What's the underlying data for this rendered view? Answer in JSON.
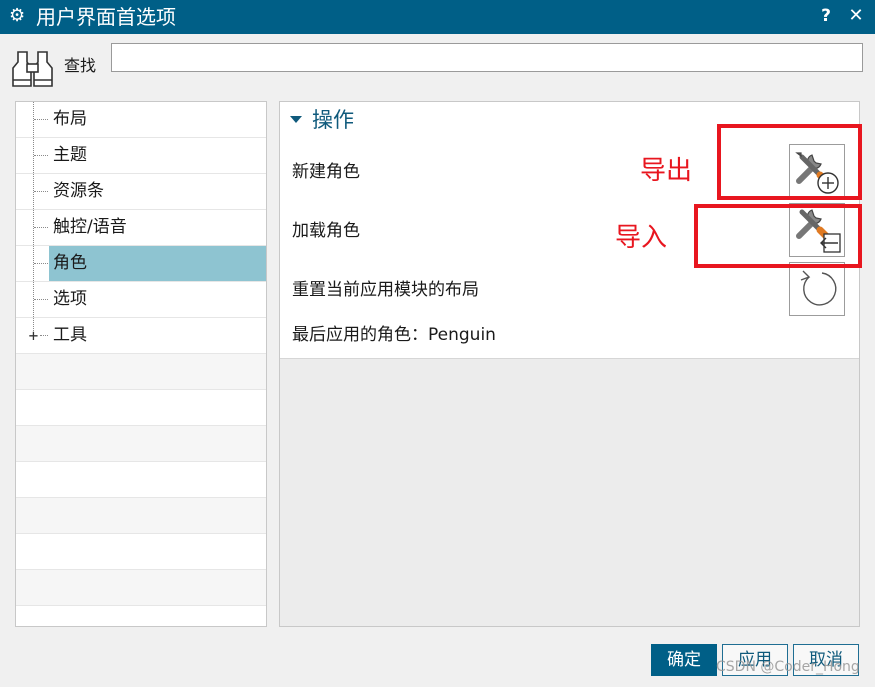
{
  "window": {
    "title": "用户界面首选项",
    "help_label": "?",
    "close_label": "✕",
    "gear_glyph": "⚙"
  },
  "search": {
    "label": "查找",
    "value": "",
    "placeholder": ""
  },
  "tree": {
    "items": [
      {
        "label": "布局",
        "selected": false
      },
      {
        "label": "主题",
        "selected": false
      },
      {
        "label": "资源条",
        "selected": false
      },
      {
        "label": "触控/语音",
        "selected": false
      },
      {
        "label": "角色",
        "selected": true
      },
      {
        "label": "选项",
        "selected": false
      },
      {
        "label": "工具",
        "selected": false,
        "expandable": true
      }
    ],
    "expand_glyph": "+"
  },
  "section": {
    "title": "操作",
    "rows": {
      "new_role": "新建角色",
      "load_role": "加载角色",
      "reset_layout": "重置当前应用模块的布局",
      "last_role": "最后应用的角色：Penguin"
    },
    "icons": {
      "new_role": "tools-add-icon",
      "load_role": "tools-import-icon",
      "reset_layout": "reset-icon"
    }
  },
  "annotations": {
    "export": "导出",
    "import": "导入",
    "color": "#e8161f"
  },
  "buttons": {
    "ok": "确定",
    "apply": "应用",
    "cancel": "取消"
  },
  "watermark": "CSDN @Coder_Hong",
  "colors": {
    "titlebar": "#005f87",
    "selection": "#8ec4d1",
    "accent_text": "#0f5a7c"
  }
}
